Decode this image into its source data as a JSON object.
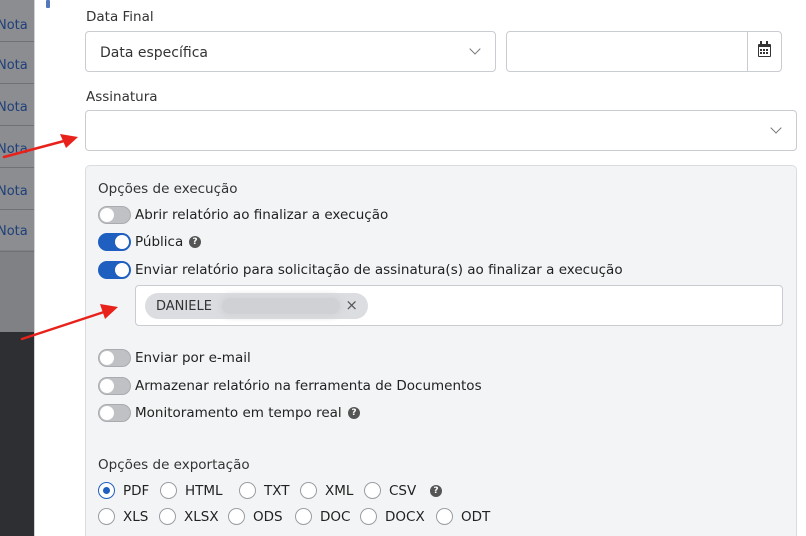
{
  "background_list": {
    "items": [
      "Nota",
      "Nota",
      "Nota",
      "Nota",
      "Nota",
      "Nota"
    ]
  },
  "data_final": {
    "label": "Data Final",
    "select_value": "Data específica",
    "date_value": ""
  },
  "assinatura": {
    "label": "Assinatura",
    "value": ""
  },
  "execution_options": {
    "title": "Opções de execução",
    "toggles": [
      {
        "label": "Abrir relatório ao finalizar a execução",
        "on": false
      },
      {
        "label": "Pública",
        "on": true,
        "help": "?"
      },
      {
        "label": "Enviar relatório para solicitação de assinatura(s) ao finalizar a execução",
        "on": true
      }
    ],
    "signer_tag": "DANIELE",
    "tag_remove": "×",
    "more_toggles": [
      {
        "label": "Enviar por e-mail",
        "on": false
      },
      {
        "label": "Armazenar relatório na ferramenta de Documentos",
        "on": false
      },
      {
        "label": "Monitoramento em tempo real",
        "on": false,
        "help": "?"
      }
    ]
  },
  "export_options": {
    "title": "Opções de exportação",
    "row1": [
      "PDF",
      "HTML",
      "TXT",
      "XML",
      "CSV"
    ],
    "row2": [
      "XLS",
      "XLSX",
      "ODS",
      "DOC",
      "DOCX",
      "ODT"
    ],
    "selected": "PDF",
    "help": "?"
  },
  "colors": {
    "accent": "#1f5fbf",
    "arrow": "#e8221b"
  }
}
